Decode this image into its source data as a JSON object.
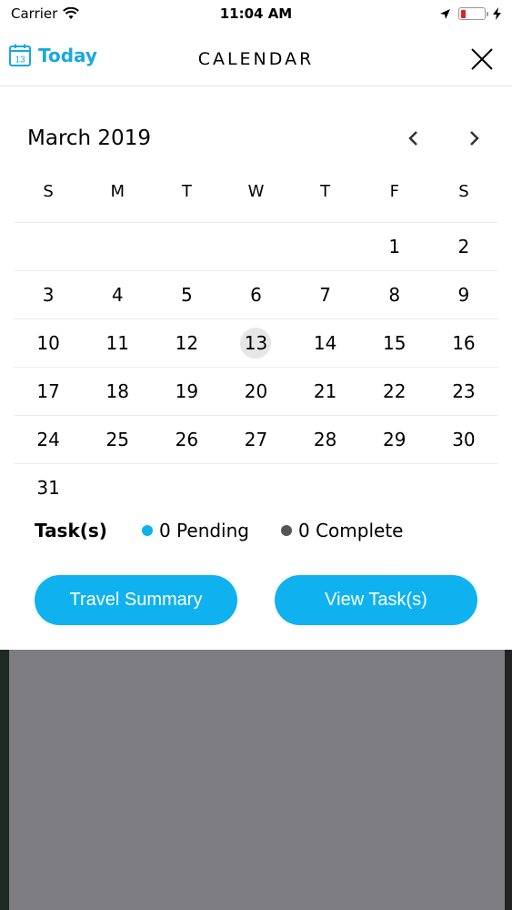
{
  "status_bar": {
    "carrier": "Carrier",
    "time": "11:04 AM",
    "battery_color": "#e02020",
    "battery_level": 0.2
  },
  "header": {
    "today_icon_day": "13",
    "today_label": "Today",
    "title": "CALENDAR",
    "close_icon": "close-icon"
  },
  "calendar": {
    "month_label": "March 2019",
    "weekdays": [
      "S",
      "M",
      "T",
      "W",
      "T",
      "F",
      "S"
    ],
    "weeks": [
      [
        "",
        "",
        "",
        "",
        "",
        "1",
        "2"
      ],
      [
        "3",
        "4",
        "5",
        "6",
        "7",
        "8",
        "9"
      ],
      [
        "10",
        "11",
        "12",
        "13",
        "14",
        "15",
        "16"
      ],
      [
        "17",
        "18",
        "19",
        "20",
        "21",
        "22",
        "23"
      ],
      [
        "24",
        "25",
        "26",
        "27",
        "28",
        "29",
        "30"
      ],
      [
        "31",
        "",
        "",
        "",
        "",
        "",
        ""
      ]
    ],
    "selected_day": "13"
  },
  "tasks": {
    "label": "Task(s)",
    "pending": {
      "text": "0 Pending",
      "color": "#0fb2ee"
    },
    "complete": {
      "text": "0 Complete",
      "color": "#555555"
    }
  },
  "buttons": {
    "travel_summary": "Travel Summary",
    "view_tasks": "View Task(s)"
  },
  "colors": {
    "accent": "#1aa8e0",
    "button": "#0fb2ee",
    "backdrop": "#7d7c80"
  }
}
